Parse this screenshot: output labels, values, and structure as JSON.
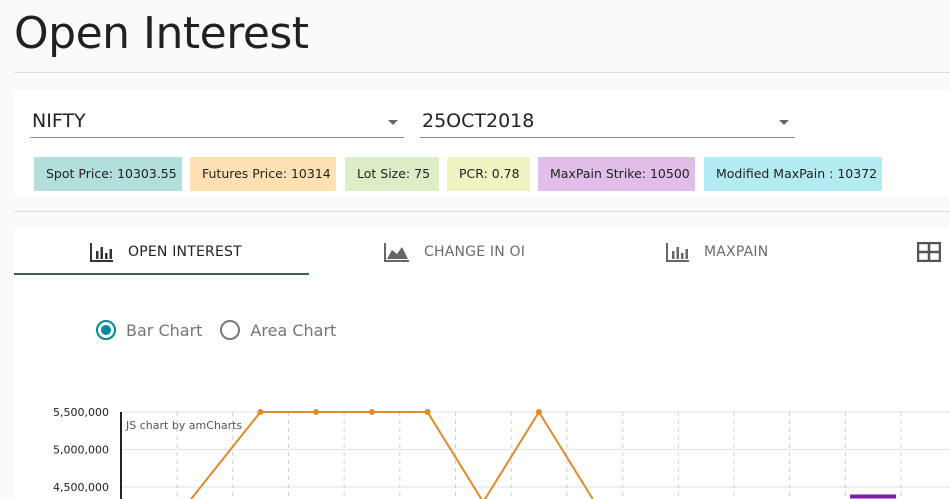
{
  "page": {
    "title": "Open Interest"
  },
  "filters": {
    "symbol": {
      "value": "NIFTY"
    },
    "expiry": {
      "value": "25OCT2018"
    }
  },
  "stats": [
    {
      "label": "Spot Price: 10303.55",
      "color": "#b2dfdb"
    },
    {
      "label": "Futures Price: 10314",
      "color": "#ffe0b2"
    },
    {
      "label": "Lot Size: 75",
      "color": "#dcedc8"
    },
    {
      "label": "PCR: 0.78",
      "color": "#f0f4c3"
    },
    {
      "label": "MaxPain Strike: 10500",
      "color": "#e1bee7"
    },
    {
      "label": "Modified MaxPain : 10372",
      "color": "#b2ebf2"
    }
  ],
  "tabs": [
    {
      "label": "OPEN INTEREST",
      "icon": "bar-chart-icon",
      "active": true
    },
    {
      "label": "CHANGE IN OI",
      "icon": "area-chart-icon",
      "active": false
    },
    {
      "label": "MAXPAIN",
      "icon": "bar-chart-icon",
      "active": false
    },
    {
      "label": "",
      "icon": "table-icon",
      "active": false
    }
  ],
  "chart_options": [
    {
      "label": "Bar Chart",
      "checked": true
    },
    {
      "label": "Area Chart",
      "checked": false
    }
  ],
  "colors": {
    "line": "#e08a2c",
    "bar": "#7b1fa2",
    "accent": "#00879a",
    "tab_indicator": "#37606a"
  },
  "chart_data": {
    "type": "line",
    "credit": "JS chart by amCharts",
    "y_ticks": [
      "5,500,000",
      "5,000,000",
      "4,500,000"
    ],
    "y_tick_values": [
      5500000,
      5000000,
      4500000
    ],
    "series": [
      {
        "values": [
          null,
          4300000,
          5500000,
          5500000,
          5500000,
          5500000,
          4300000,
          5500000,
          4300000
        ]
      }
    ],
    "bar_hint": {
      "category_index": 13,
      "value": 4400000
    }
  }
}
